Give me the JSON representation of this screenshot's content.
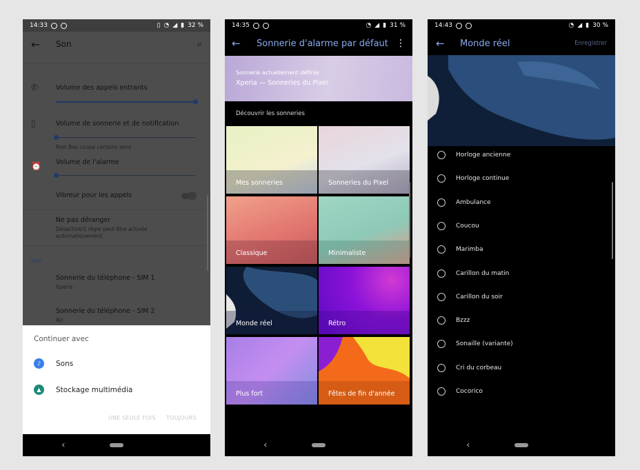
{
  "phone1": {
    "status": {
      "time": "14:33",
      "battery": "32 %"
    },
    "appbar": {
      "title": "Son"
    },
    "settings": {
      "incoming": {
        "label": "Volume des appels entrants",
        "level": 1.0
      },
      "ringtone": {
        "label": "Volume de sonnerie et de notification",
        "sub": "Post Box coupe certains sons",
        "level": 0.0
      },
      "alarm": {
        "label": "Volume de l'alarme",
        "level": 0.0
      },
      "vibrate": {
        "label": "Vibreur pour les appels"
      },
      "dnd": {
        "label": "Ne pas déranger",
        "sub1": "Désactivé/1 règle peut être activée",
        "sub2": "automatiquement"
      },
      "section": "Son",
      "sim1": {
        "label": "Sonnerie du téléphone - SIM 1",
        "sub": "Xperia"
      },
      "sim2": {
        "label": "Sonnerie du téléphone - SIM 2",
        "sub": "Air"
      }
    },
    "sheet": {
      "title": "Continuer avec",
      "options": [
        {
          "label": "Sons",
          "icon": "sounds-app-icon",
          "color": "#3a7ee8"
        },
        {
          "label": "Stockage multimédia",
          "icon": "android-icon",
          "color": "#1e8a78"
        }
      ],
      "once": "UNE SEULE FOIS",
      "always": "TOUJOURS"
    }
  },
  "phone2": {
    "status": {
      "time": "14:35",
      "battery": "31 %"
    },
    "appbar": {
      "title": "Sonnerie d'alarme par défaut"
    },
    "banner": {
      "caption": "Sonnerie actuellement définie",
      "value": "Xperia — Sonneries du Pixel"
    },
    "section": "Découvrir les sonneries",
    "tiles": [
      {
        "label": "Mes sonneries"
      },
      {
        "label": "Sonneries du Pixel"
      },
      {
        "label": "Classique"
      },
      {
        "label": "Minimaliste"
      },
      {
        "label": "Monde réel"
      },
      {
        "label": "Rétro"
      },
      {
        "label": "Plus fort"
      },
      {
        "label": "Fêtes de fin d'année"
      }
    ]
  },
  "phone3": {
    "status": {
      "time": "14:43",
      "battery": "30 %"
    },
    "appbar": {
      "title": "Monde réel",
      "save": "Enregistrer"
    },
    "sounds": [
      "Horloge ancienne",
      "Horloge continue",
      "Ambulance",
      "Coucou",
      "Marimba",
      "Carillon du matin",
      "Carillon du soir",
      "Bzzz",
      "Sonaille (variante)",
      "Cri du corbeau",
      "Cocorico"
    ]
  }
}
